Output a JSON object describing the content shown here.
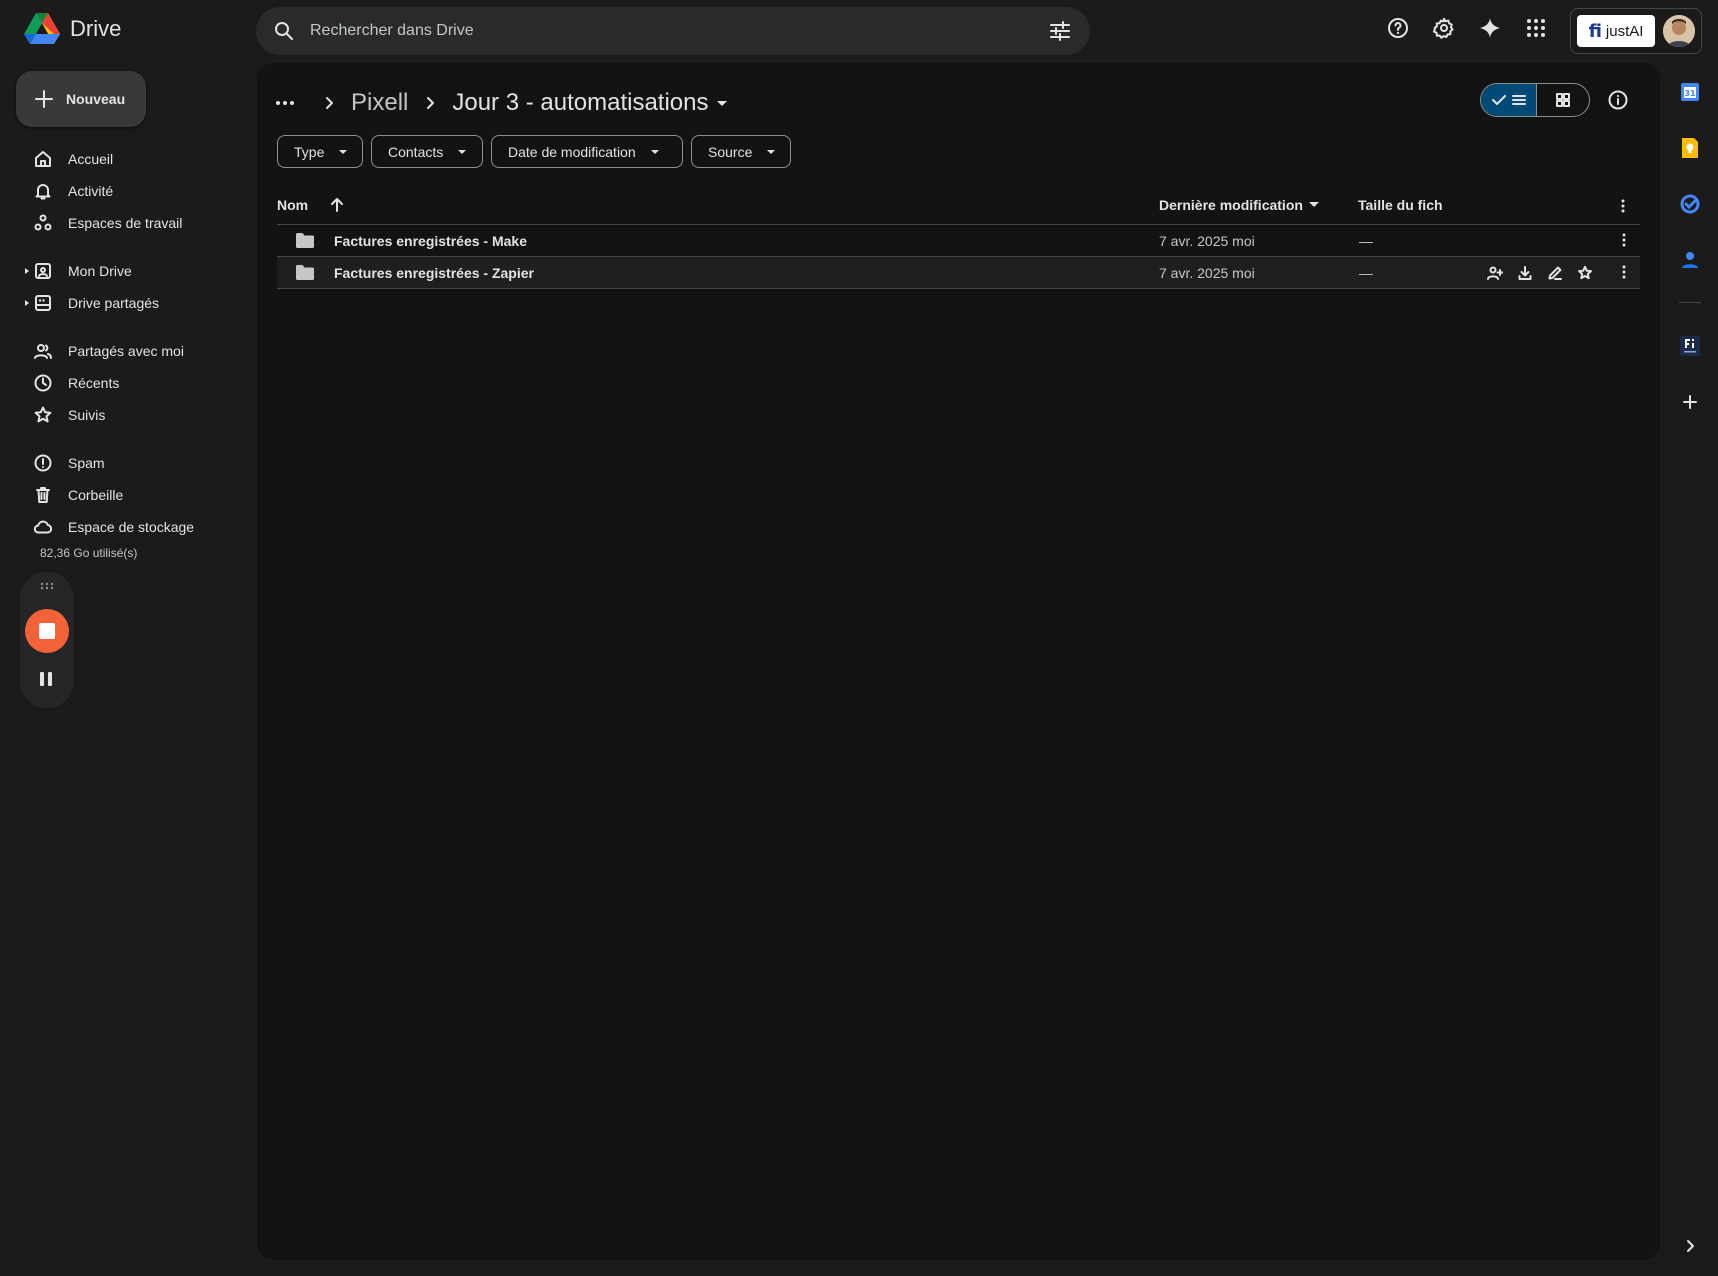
{
  "app": {
    "title": "Drive"
  },
  "search": {
    "placeholder": "Rechercher dans Drive"
  },
  "account": {
    "brand_fi": "fi",
    "brand_text": "justAI"
  },
  "sidebar": {
    "new_label": "Nouveau",
    "items": [
      {
        "label": "Accueil",
        "icon": "home-icon"
      },
      {
        "label": "Activité",
        "icon": "bell-icon"
      },
      {
        "label": "Espaces de travail",
        "icon": "workspaces-icon"
      },
      {
        "label": "Mon Drive",
        "icon": "my-drive-icon"
      },
      {
        "label": "Drive partagés",
        "icon": "shared-drives-icon"
      },
      {
        "label": "Partagés avec moi",
        "icon": "people-icon"
      },
      {
        "label": "Récents",
        "icon": "clock-icon"
      },
      {
        "label": "Suivis",
        "icon": "star-icon"
      },
      {
        "label": "Spam",
        "icon": "spam-icon"
      },
      {
        "label": "Corbeille",
        "icon": "trash-icon"
      },
      {
        "label": "Espace de stockage",
        "icon": "cloud-icon"
      }
    ],
    "storage_used": "82,36 Go utilisé(s)"
  },
  "breadcrumb": {
    "parent": "Pixell",
    "current": "Jour 3 - automatisations"
  },
  "filters": [
    "Type",
    "Contacts",
    "Date de modification",
    "Source"
  ],
  "table": {
    "columns": {
      "name": "Nom",
      "modified": "Dernière modification",
      "size": "Taille du fich"
    },
    "rows": [
      {
        "name": "Factures enregistrées - Make",
        "modified": "7 avr. 2025 moi",
        "size": "—"
      },
      {
        "name": "Factures enregistrées - Zapier",
        "modified": "7 avr. 2025 moi",
        "size": "—"
      }
    ]
  },
  "colors": {
    "background": "#1b1b1b",
    "surface": "#131313",
    "accent_selected": "#004a77",
    "record": "#f4623a"
  }
}
